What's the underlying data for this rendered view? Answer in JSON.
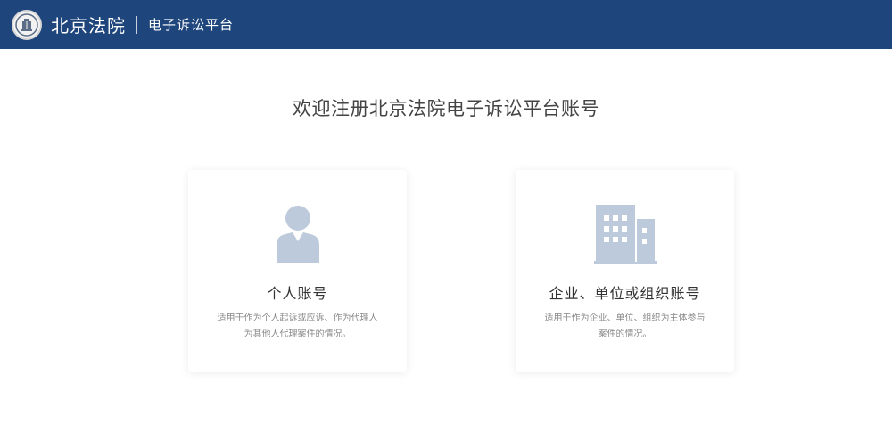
{
  "header": {
    "court_name": "北京法院",
    "platform_name": "电子诉讼平台",
    "background_color": "#1f467c"
  },
  "main": {
    "title": "欢迎注册北京法院电子诉讼平台账号",
    "cards": [
      {
        "title": "个人账号",
        "description": "适用于作为个人起诉或应诉、作为代理人为其他人代理案件的情况。",
        "icon": "person-icon"
      },
      {
        "title": "企业、单位或组织账号",
        "description": "适用于作为企业、单位、组织为主体参与案件的情况。",
        "icon": "building-icon"
      }
    ],
    "icon_color": "#bccadb"
  }
}
